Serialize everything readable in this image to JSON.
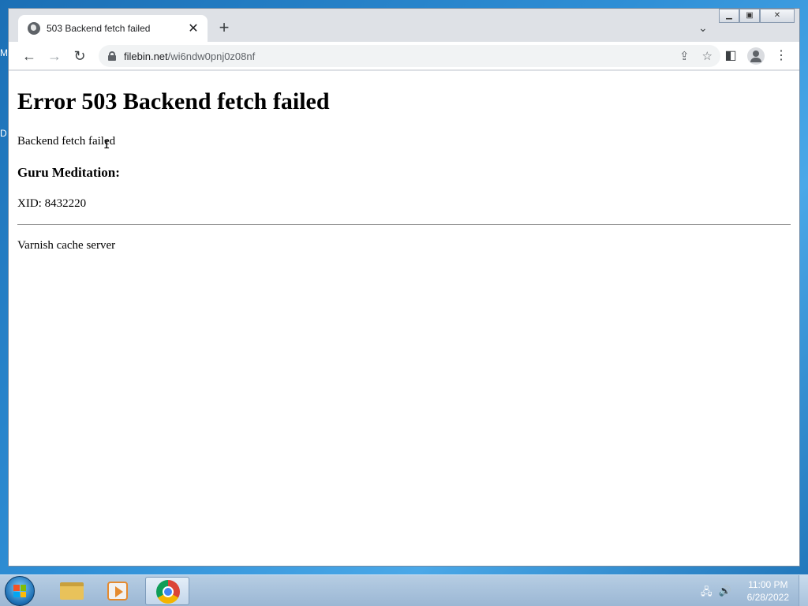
{
  "desktop": {
    "edge_labels": [
      "M",
      "D"
    ]
  },
  "browser": {
    "tab": {
      "title": "503 Backend fetch failed",
      "close_glyph": "✕"
    },
    "new_tab_glyph": "+",
    "omnibox": {
      "host": "filebin.net",
      "path": "/wi6ndw0pnj0z08nf"
    }
  },
  "page": {
    "heading": "Error 503 Backend fetch failed",
    "message": "Backend fetch failed",
    "subheading": "Guru Meditation:",
    "xid": "XID: 8432220",
    "footer": "Varnish cache server"
  },
  "taskbar": {
    "apps": [
      "file-explorer",
      "media-player",
      "google-chrome"
    ],
    "clock": {
      "time": "11:00 PM",
      "date": "6/28/2022"
    }
  }
}
